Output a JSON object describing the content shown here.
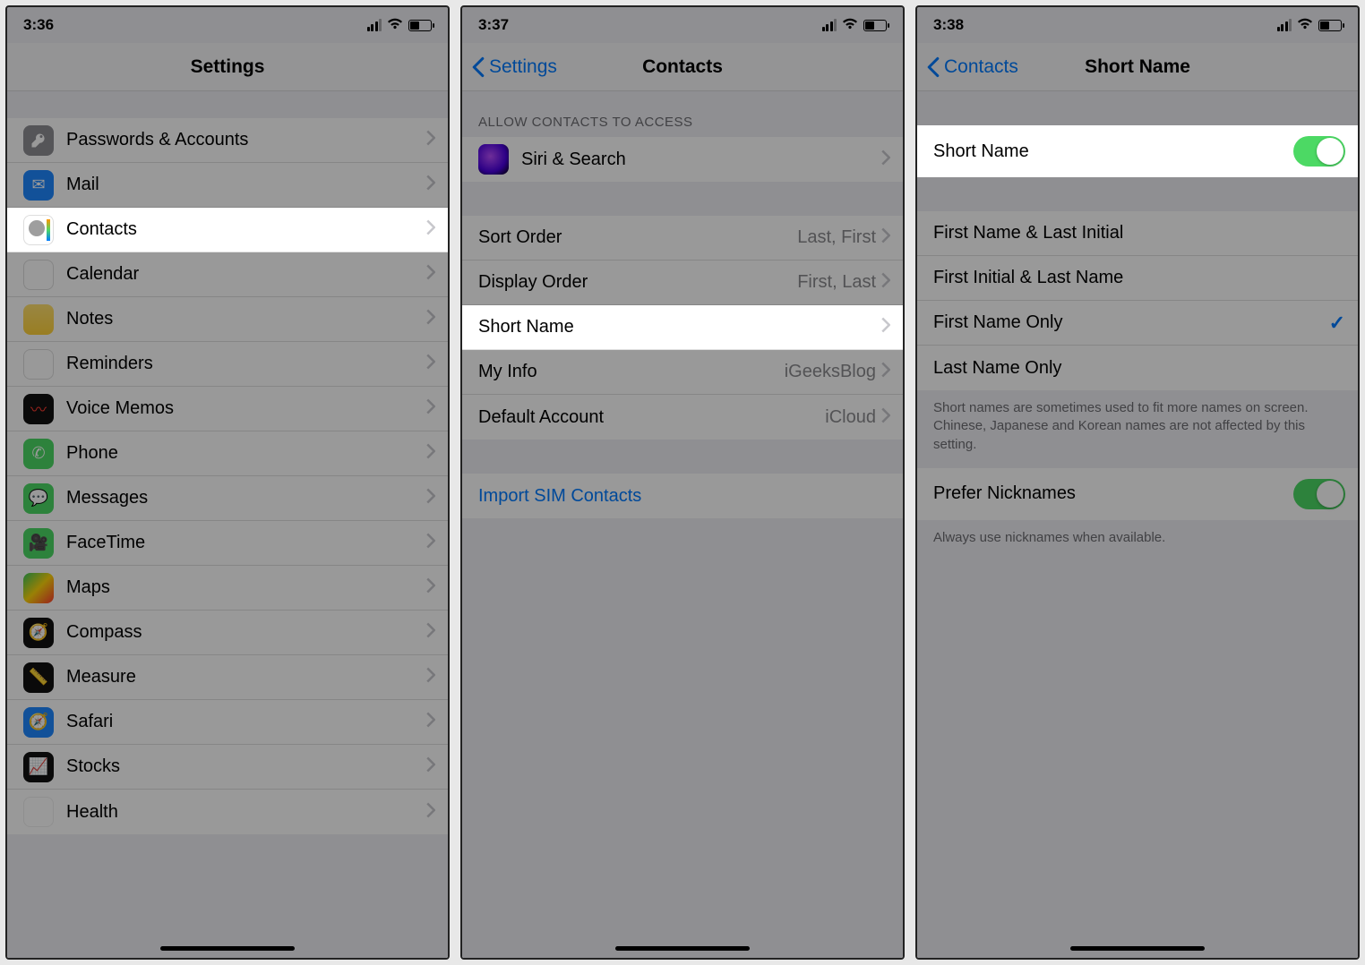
{
  "screens": [
    {
      "time": "3:36",
      "title": "Settings",
      "rows": [
        {
          "label": "Passwords & Accounts",
          "chevron": true
        },
        {
          "label": "Mail",
          "chevron": true
        },
        {
          "label": "Contacts",
          "chevron": true,
          "highlight": true
        },
        {
          "label": "Calendar",
          "chevron": true
        },
        {
          "label": "Notes",
          "chevron": true
        },
        {
          "label": "Reminders",
          "chevron": true
        },
        {
          "label": "Voice Memos",
          "chevron": true
        },
        {
          "label": "Phone",
          "chevron": true
        },
        {
          "label": "Messages",
          "chevron": true
        },
        {
          "label": "FaceTime",
          "chevron": true
        },
        {
          "label": "Maps",
          "chevron": true
        },
        {
          "label": "Compass",
          "chevron": true
        },
        {
          "label": "Measure",
          "chevron": true
        },
        {
          "label": "Safari",
          "chevron": true
        },
        {
          "label": "Stocks",
          "chevron": true
        },
        {
          "label": "Health",
          "chevron": true
        }
      ]
    },
    {
      "time": "3:37",
      "title": "Contacts",
      "back": "Settings",
      "section_header": "ALLOW CONTACTS TO ACCESS",
      "siri": {
        "label": "Siri & Search"
      },
      "options": [
        {
          "label": "Sort Order",
          "value": "Last, First"
        },
        {
          "label": "Display Order",
          "value": "First, Last"
        },
        {
          "label": "Short Name",
          "highlight": true
        },
        {
          "label": "My Info",
          "value": "iGeeksBlog"
        },
        {
          "label": "Default Account",
          "value": "iCloud"
        }
      ],
      "import": "Import SIM Contacts"
    },
    {
      "time": "3:38",
      "title": "Short Name",
      "back": "Contacts",
      "short_name_toggle": {
        "label": "Short Name",
        "on": true
      },
      "options": [
        {
          "label": "First Name & Last Initial"
        },
        {
          "label": "First Initial & Last Name"
        },
        {
          "label": "First Name Only",
          "checked": true
        },
        {
          "label": "Last Name Only"
        }
      ],
      "footer": "Short names are sometimes used to fit more names on screen. Chinese, Japanese and Korean names are not affected by this setting.",
      "nickname": {
        "label": "Prefer Nicknames",
        "on": true
      },
      "nickname_footer": "Always use nicknames when available."
    }
  ]
}
